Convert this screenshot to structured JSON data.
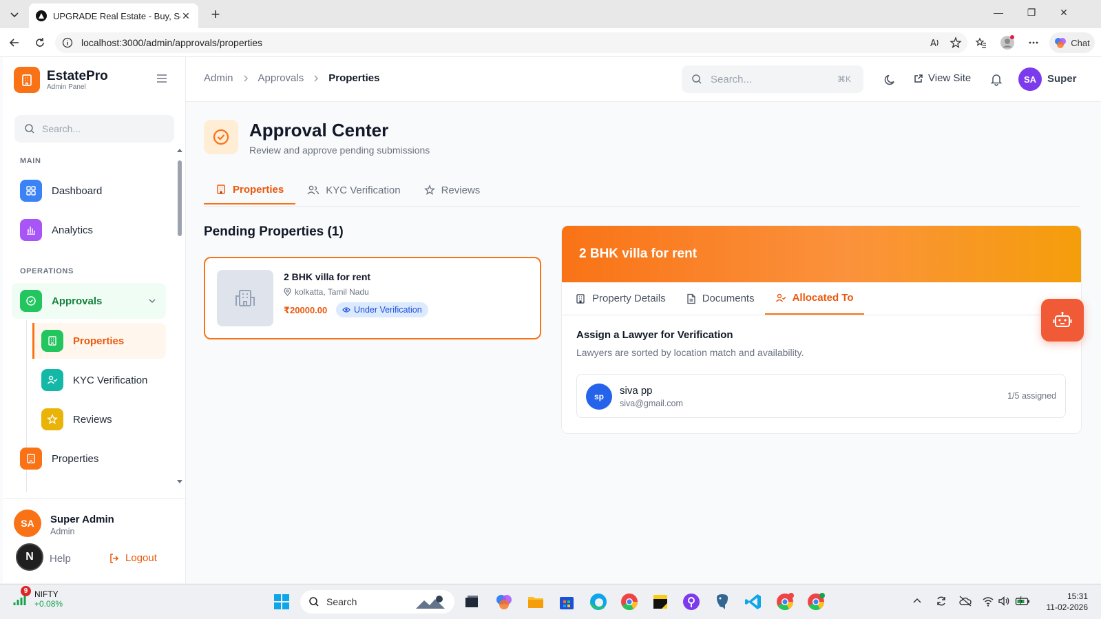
{
  "browser": {
    "tab_title": "UPGRADE Real Estate - Buy, Sell &",
    "url": "localhost:3000/admin/approvals/properties",
    "chat_label": "Chat"
  },
  "sidebar": {
    "brand": "EstatePro",
    "brand_sub": "Admin Panel",
    "search_placeholder": "Search...",
    "section_main": "MAIN",
    "section_operations": "OPERATIONS",
    "items": {
      "dashboard": "Dashboard",
      "analytics": "Analytics",
      "approvals": "Approvals",
      "sub_properties": "Properties",
      "sub_kyc": "KYC Verification",
      "sub_reviews": "Reviews",
      "properties": "Properties"
    },
    "user_initials": "SA",
    "user_name": "Super Admin",
    "user_role": "Admin",
    "help": "Help",
    "logout": "Logout"
  },
  "topbar": {
    "breadcrumb": [
      "Admin",
      "Approvals",
      "Properties"
    ],
    "search_placeholder": "Search...",
    "search_shortcut": "⌘K",
    "view_site": "View Site",
    "user_initials": "SA",
    "user_name": "Super"
  },
  "page": {
    "title": "Approval Center",
    "subtitle": "Review and approve pending submissions",
    "tabs": [
      "Properties",
      "KYC Verification",
      "Reviews"
    ],
    "pending_title": "Pending Properties (1)"
  },
  "property": {
    "name": "2 BHK villa for rent",
    "location": "kolkatta, Tamil Nadu",
    "price": "₹20000.00",
    "status": "Under Verification"
  },
  "detail": {
    "title": "2 BHK villa for rent",
    "tabs": [
      "Property Details",
      "Documents",
      "Allocated To"
    ],
    "assign_title": "Assign a Lawyer for Verification",
    "assign_sub": "Lawyers are sorted by location match and availability.",
    "lawyer": {
      "initials": "sp",
      "name": "siva pp",
      "email": "siva@gmail.com",
      "count": "1/5 assigned"
    }
  },
  "taskbar": {
    "ticker_badge": "9",
    "ticker_name": "NIFTY",
    "ticker_change": "+0.08%",
    "search": "Search",
    "time": "15:31",
    "date": "11-02-2026"
  },
  "colors": {
    "accent": "#f97316",
    "accent_dark": "#ea580c",
    "approvals_green": "#22c55e",
    "dashboard_blue": "#3b82f6",
    "analytics_purple": "#a855f7",
    "kyc_teal": "#14b8a6",
    "reviews_yellow": "#eab308",
    "badge_blue": "#1d4ed8"
  }
}
